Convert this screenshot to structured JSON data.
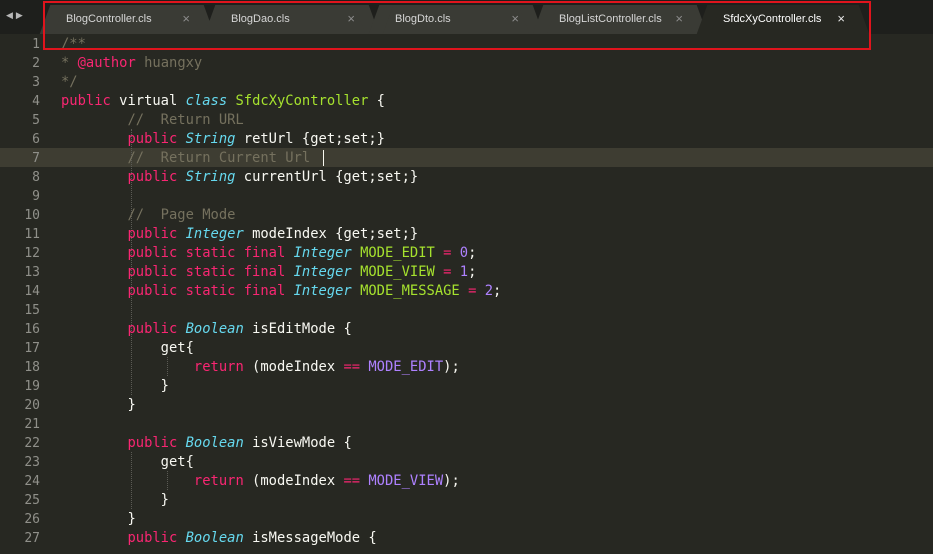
{
  "nav": {
    "back_label": "◀",
    "forward_label": "▶"
  },
  "tabs": [
    {
      "label": "BlogController.cls",
      "close": "×",
      "active": false
    },
    {
      "label": "BlogDao.cls",
      "close": "×",
      "active": false
    },
    {
      "label": "BlogDto.cls",
      "close": "×",
      "active": false
    },
    {
      "label": "BlogListController.cls",
      "close": "×",
      "active": false
    },
    {
      "label": "SfdcXyController.cls",
      "close": "×",
      "active": true
    }
  ],
  "editor": {
    "current_line": 7,
    "line_numbers": [
      "1",
      "2",
      "3",
      "4",
      "5",
      "6",
      "7",
      "8",
      "9",
      "10",
      "11",
      "12",
      "13",
      "14",
      "15",
      "16",
      "17",
      "18",
      "19",
      "20",
      "21",
      "22",
      "23",
      "24",
      "25",
      "26",
      "27"
    ],
    "lines": [
      [
        [
          "c",
          "/**"
        ]
      ],
      [
        [
          "c",
          "* "
        ],
        [
          "k",
          "@author"
        ],
        [
          "c",
          " huangxy"
        ]
      ],
      [
        [
          "c",
          "*/"
        ]
      ],
      [
        [
          "k",
          "public"
        ],
        [
          "p",
          " virtual "
        ],
        [
          "sk",
          "class"
        ],
        [
          "p",
          " "
        ],
        [
          "cls",
          "SfdcXyController"
        ],
        [
          "p",
          " {"
        ]
      ],
      [
        [
          "p",
          "        "
        ],
        [
          "c",
          "//  Return URL"
        ]
      ],
      [
        [
          "p",
          "        "
        ],
        [
          "k",
          "public"
        ],
        [
          "p",
          " "
        ],
        [
          "t",
          "String"
        ],
        [
          "p",
          " retUrl {get;set;}"
        ]
      ],
      [
        [
          "p",
          "        "
        ],
        [
          "c",
          "//  Return Current Url"
        ]
      ],
      [
        [
          "p",
          "        "
        ],
        [
          "k",
          "public"
        ],
        [
          "p",
          " "
        ],
        [
          "t",
          "String"
        ],
        [
          "p",
          " currentUrl {get;set;}"
        ]
      ],
      [],
      [
        [
          "p",
          "        "
        ],
        [
          "c",
          "//  Page Mode"
        ]
      ],
      [
        [
          "p",
          "        "
        ],
        [
          "k",
          "public"
        ],
        [
          "p",
          " "
        ],
        [
          "t",
          "Integer"
        ],
        [
          "p",
          " modeIndex {get;set;}"
        ]
      ],
      [
        [
          "p",
          "        "
        ],
        [
          "k",
          "public static final"
        ],
        [
          "p",
          " "
        ],
        [
          "t",
          "Integer"
        ],
        [
          "p",
          " "
        ],
        [
          "g",
          "MODE_EDIT"
        ],
        [
          "p",
          " "
        ],
        [
          "k",
          "="
        ],
        [
          "p",
          " "
        ],
        [
          "n",
          "0"
        ],
        [
          "p",
          ";"
        ]
      ],
      [
        [
          "p",
          "        "
        ],
        [
          "k",
          "public static final"
        ],
        [
          "p",
          " "
        ],
        [
          "t",
          "Integer"
        ],
        [
          "p",
          " "
        ],
        [
          "g",
          "MODE_VIEW"
        ],
        [
          "p",
          " "
        ],
        [
          "k",
          "="
        ],
        [
          "p",
          " "
        ],
        [
          "n",
          "1"
        ],
        [
          "p",
          ";"
        ]
      ],
      [
        [
          "p",
          "        "
        ],
        [
          "k",
          "public static final"
        ],
        [
          "p",
          " "
        ],
        [
          "t",
          "Integer"
        ],
        [
          "p",
          " "
        ],
        [
          "g",
          "MODE_MESSAGE"
        ],
        [
          "p",
          " "
        ],
        [
          "k",
          "="
        ],
        [
          "p",
          " "
        ],
        [
          "n",
          "2"
        ],
        [
          "p",
          ";"
        ]
      ],
      [],
      [
        [
          "p",
          "        "
        ],
        [
          "k",
          "public"
        ],
        [
          "p",
          " "
        ],
        [
          "t",
          "Boolean"
        ],
        [
          "p",
          " isEditMode {"
        ]
      ],
      [
        [
          "p",
          "            get{"
        ]
      ],
      [
        [
          "p",
          "                "
        ],
        [
          "k",
          "return"
        ],
        [
          "p",
          " (modeIndex "
        ],
        [
          "k",
          "=="
        ],
        [
          "p",
          " "
        ],
        [
          "cst",
          "MODE_EDIT"
        ],
        [
          "p",
          ");"
        ]
      ],
      [
        [
          "p",
          "            }"
        ]
      ],
      [
        [
          "p",
          "        }"
        ]
      ],
      [],
      [
        [
          "p",
          "        "
        ],
        [
          "k",
          "public"
        ],
        [
          "p",
          " "
        ],
        [
          "t",
          "Boolean"
        ],
        [
          "p",
          " isViewMode {"
        ]
      ],
      [
        [
          "p",
          "            get{"
        ]
      ],
      [
        [
          "p",
          "                "
        ],
        [
          "k",
          "return"
        ],
        [
          "p",
          " (modeIndex "
        ],
        [
          "k",
          "=="
        ],
        [
          "p",
          " "
        ],
        [
          "cst",
          "MODE_VIEW"
        ],
        [
          "p",
          ");"
        ]
      ],
      [
        [
          "p",
          "            }"
        ]
      ],
      [
        [
          "p",
          "        }"
        ]
      ],
      [
        [
          "p",
          "        "
        ],
        [
          "k",
          "public"
        ],
        [
          "p",
          " "
        ],
        [
          "t",
          "Boolean"
        ],
        [
          "p",
          " isMessageMode {"
        ]
      ]
    ]
  }
}
